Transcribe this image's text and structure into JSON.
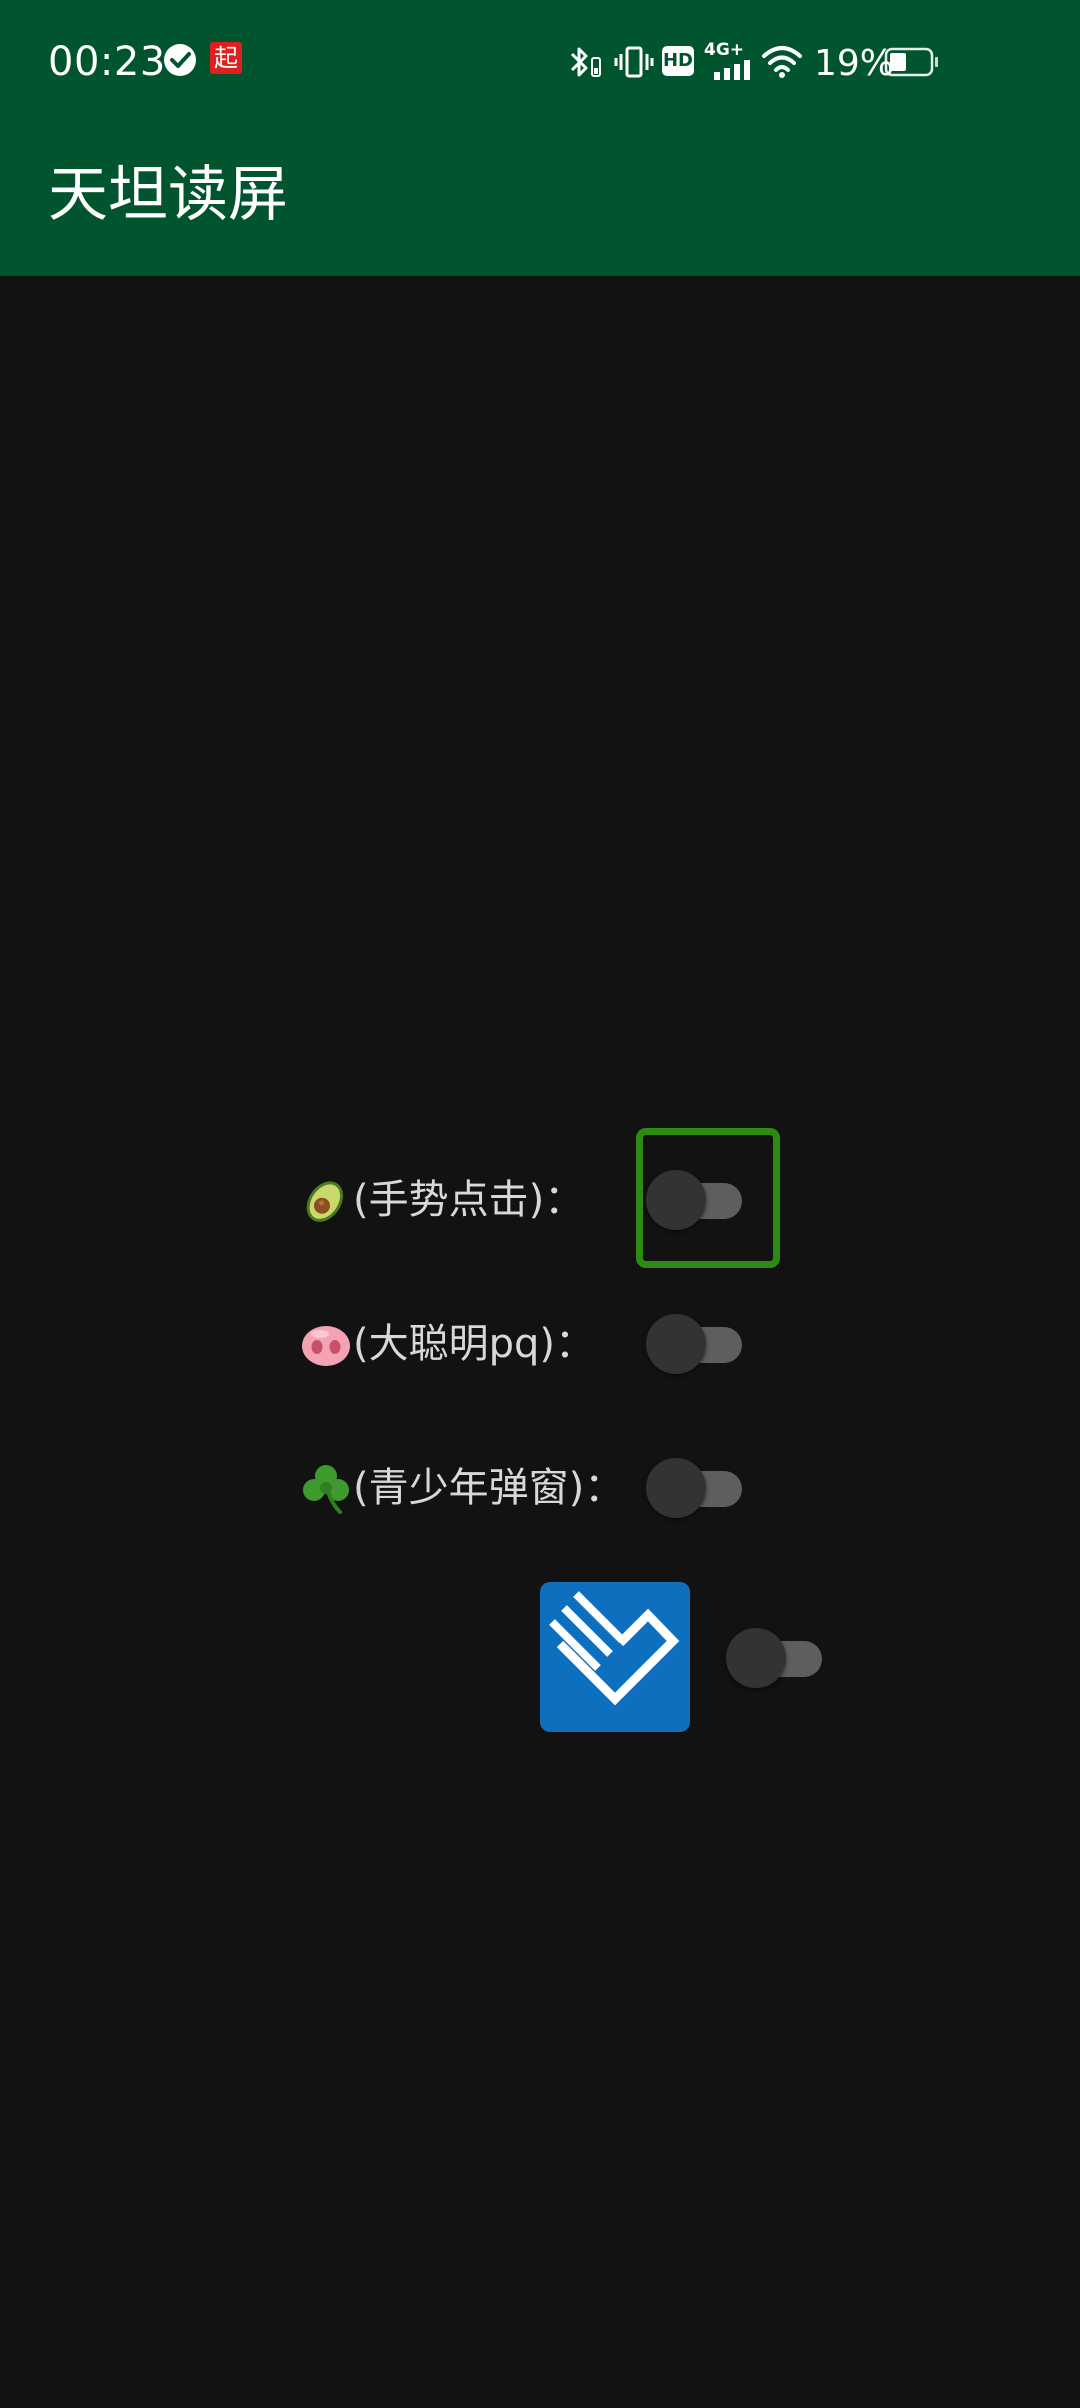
{
  "status_bar": {
    "time": "00:23",
    "battery_percent": "19%",
    "battery_level": 0.19,
    "left_icons": [
      "check-circle-icon",
      "qidian-app-icon"
    ],
    "right_icons": [
      "bluetooth-icon",
      "vibrate-icon",
      "hd-icon",
      "4g-signal-icon",
      "wifi-icon",
      "battery-icon"
    ],
    "network_label": "4G+",
    "hd_label": "HD",
    "app_badge_char": "起"
  },
  "app_bar": {
    "title": "天坦读屏",
    "color": "#01552e"
  },
  "toggles": [
    {
      "emoji": "avocado-icon",
      "label": "(手势点击)：",
      "on": false,
      "highlighted": true
    },
    {
      "emoji": "pig-nose-icon",
      "label": "(大聪明pq)：",
      "on": false,
      "highlighted": false
    },
    {
      "emoji": "shamrock-icon",
      "label": "(青少年弹窗)：",
      "on": false,
      "highlighted": false
    }
  ],
  "icon_toggle": {
    "icon": "app-logo-icon",
    "on": false
  },
  "colors": {
    "background": "#121212",
    "highlight": "#2e8b12",
    "app_icon_bg": "#0e6fbf"
  }
}
